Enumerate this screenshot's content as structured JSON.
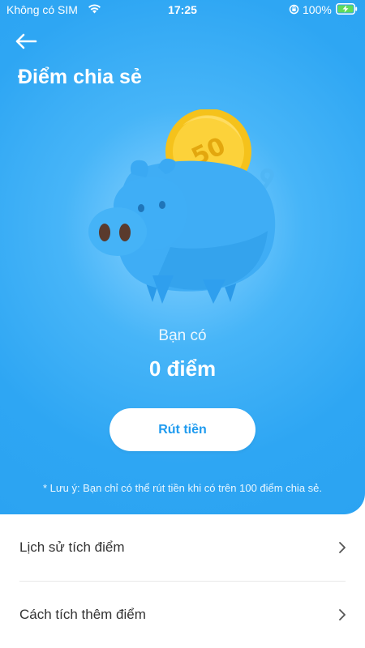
{
  "status_bar": {
    "carrier": "Không có SIM",
    "time": "17:25",
    "battery_percent": "100%"
  },
  "header": {
    "back_icon": "arrow-left-icon",
    "title": "Điểm chia sẻ"
  },
  "illustration": {
    "coin_label": "50"
  },
  "points": {
    "caption": "Bạn có",
    "value": "0 điểm"
  },
  "withdraw_button": {
    "label": "Rút tiền"
  },
  "note": "* Lưu ý: Bạn chỉ có thể rút tiền khi có trên 100 điểm chia sẻ.",
  "menu": [
    {
      "label": "Lịch sử tích điểm",
      "icon": "chevron-right-icon"
    },
    {
      "label": "Cách tích thêm điểm",
      "icon": "chevron-right-icon"
    }
  ],
  "colors": {
    "hero_blue": "#2ea6f3",
    "button_text": "#1f9bef",
    "coin_gold": "#f7c51f"
  }
}
